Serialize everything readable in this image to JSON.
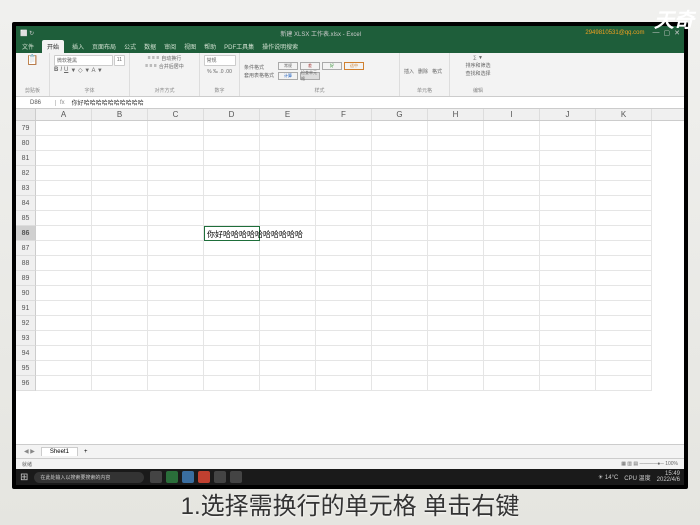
{
  "watermark": "天奇",
  "title_bar": {
    "center": "新建 XLSX 工作表.xlsx - Excel",
    "account": "2949810531@qq.com",
    "min": "—",
    "max": "▢",
    "close": "✕"
  },
  "tabs": {
    "file": "文件",
    "home": "开始",
    "insert": "插入",
    "layout": "页面布局",
    "formulas": "公式",
    "data": "数据",
    "review": "审阅",
    "view": "视图",
    "help": "帮助",
    "pdf": "PDF工具集",
    "tell": "操作说明搜索"
  },
  "ribbon": {
    "clipboard": "剪贴板",
    "font": "字体",
    "font_name": "微软雅黑",
    "font_size": "11",
    "align": "对齐方式",
    "wrap": "自动换行",
    "merge": "合并后居中",
    "number": "数字",
    "number_fmt": "常规",
    "styles": "样式",
    "cond_fmt": "条件格式",
    "fmt_table": "套用表格格式",
    "style_normal": "常规",
    "style_bad": "差",
    "style_good": "好",
    "style_neutral": "适中",
    "style_calc": "计算",
    "style_check": "检查单元格",
    "cells": "单元格",
    "insert_c": "插入",
    "delete_c": "删除",
    "format_c": "格式",
    "editing": "编辑",
    "sum": "∑",
    "sort": "排序和筛选",
    "find": "查找和选择"
  },
  "formula_bar": {
    "name_box": "D86",
    "fx": "fx",
    "content": "你好哈哈哈哈哈哈哈哈哈哈"
  },
  "columns": [
    "A",
    "B",
    "C",
    "D",
    "E",
    "F",
    "G",
    "H",
    "I",
    "J",
    "K"
  ],
  "rows": [
    79,
    80,
    81,
    82,
    83,
    84,
    85,
    86,
    87,
    88,
    89,
    90,
    91,
    92,
    93,
    94,
    95,
    96
  ],
  "selected_row": 86,
  "selected_col": "D",
  "cell_value": "你好哈哈哈哈哈哈哈哈哈哈",
  "sheet": {
    "name": "Sheet1",
    "plus": "+"
  },
  "status": {
    "ready": "就绪",
    "zoom": "100%"
  },
  "taskbar": {
    "search": "在此处输入以搜索要搜索的内容",
    "weather": "14°C",
    "cpu": "CPU 温度",
    "time": "15:49",
    "date": "2022/4/6"
  },
  "caption": "1.选择需换行的单元格 单击右键"
}
